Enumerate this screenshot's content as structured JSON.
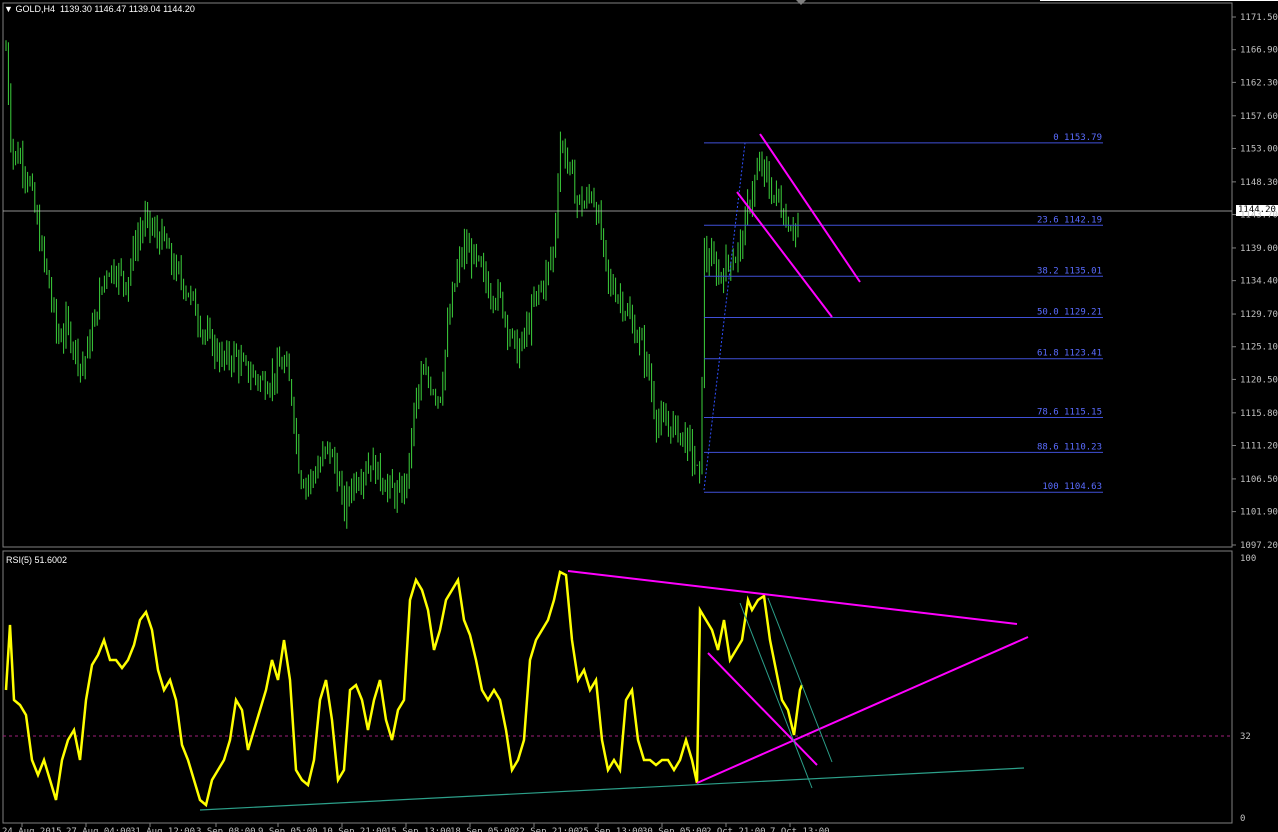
{
  "header": {
    "arrow": "▼",
    "symbol_timeframe": "GOLD,H4",
    "ohlc": "1139.30 1146.47 1139.04 1144.20"
  },
  "price_axis": [
    "1171.50",
    "1166.90",
    "1162.30",
    "1157.60",
    "1153.00",
    "1148.30",
    "1143.70",
    "1139.00",
    "1134.40",
    "1129.70",
    "1125.10",
    "1120.50",
    "1115.80",
    "1111.20",
    "1106.50",
    "1101.90",
    "1097.20"
  ],
  "current_price": "1144.20",
  "fibonacci": [
    {
      "level": "0",
      "price": "1153.79"
    },
    {
      "level": "23.6",
      "price": "1142.19"
    },
    {
      "level": "38.2",
      "price": "1135.01"
    },
    {
      "level": "50.0",
      "price": "1129.21"
    },
    {
      "level": "61.8",
      "price": "1123.41"
    },
    {
      "level": "78.6",
      "price": "1115.15"
    },
    {
      "level": "88.6",
      "price": "1110.23"
    },
    {
      "level": "100",
      "price": "1104.63"
    }
  ],
  "rsi": {
    "label": "RSI(5) 51.6002",
    "axis": [
      "100",
      "32",
      "0"
    ]
  },
  "time_axis": [
    "24 Aug 2015",
    "27 Aug 04:00",
    "31 Aug 12:00",
    "3 Sep 08:00",
    "9 Sep 05:00",
    "10 Sep 21:00",
    "15 Sep 13:00",
    "18 Sep 05:00",
    "22 Sep 21:00",
    "25 Sep 13:00",
    "30 Sep 05:00",
    "2 Oct 21:00",
    "7 Oct 13:00"
  ],
  "colors": {
    "candles": "#3cd23c",
    "rsi_line": "#ffff00",
    "fib_lines": "#4050d8",
    "fib_text": "#5a6cff",
    "trendlines": "#ff00ff",
    "support_line": "#2ca08a",
    "price_line": "#c0c0c0"
  }
}
